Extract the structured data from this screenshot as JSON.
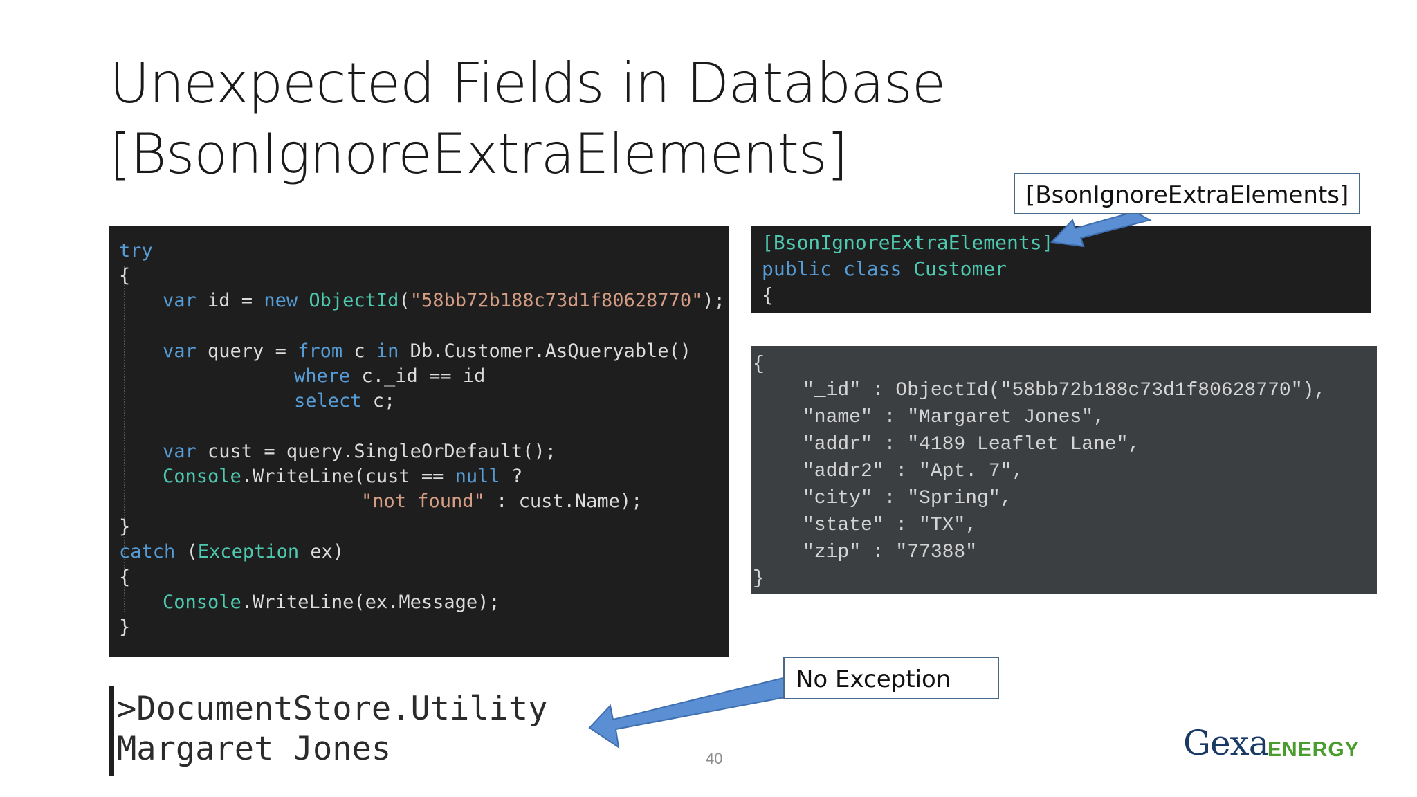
{
  "slide": {
    "title_line1": "Unexpected Fields in Database",
    "title_line2": "[BsonIgnoreExtraElements]",
    "page_number": "40"
  },
  "code_left": {
    "try_kw": "try",
    "open1": "{",
    "l3_var": "var",
    "l3_id": " id = ",
    "l3_new": "new",
    "l3_type": " ObjectId",
    "l3_paren": "(",
    "l3_str": "\"58bb72b188c73d1f80628770\"",
    "l3_end": ");",
    "l4_var": "var",
    "l4_query": " query = ",
    "l4_from": "from",
    "l4_c": " c ",
    "l4_in": "in",
    "l4_rest": " Db.Customer.AsQueryable()",
    "l5_where": "where",
    "l5_rest": " c._id == id",
    "l6_select": "select",
    "l6_rest": " c;",
    "l7_var": "var",
    "l7_rest": " cust = query.SingleOrDefault();",
    "l8_console": "Console",
    "l8_mid": ".WriteLine(cust == ",
    "l8_null": "null",
    "l8_end": " ?",
    "l9_str": "\"not found\"",
    "l9_rest": " : cust.Name);",
    "close1": "}",
    "catch_kw": "catch",
    "catch_open": " (",
    "exception_type": "Exception",
    "catch_rest": " ex)",
    "open2": "{",
    "l10_console": "Console",
    "l10_rest": ".WriteLine(ex.Message);",
    "close2": "}"
  },
  "code_class": {
    "attribute": "[BsonIgnoreExtraElements]",
    "public_kw": "public",
    "class_kw": " class",
    "class_name": " Customer",
    "open": "{"
  },
  "json_doc": {
    "open": "{",
    "rows": [
      "\"_id\" : ObjectId(\"58bb72b188c73d1f80628770\"),",
      "\"name\" : \"Margaret Jones\",",
      "\"addr\" : \"4189 Leaflet Lane\",",
      "\"addr2\" : \"Apt. 7\",",
      "\"city\" : \"Spring\",",
      "\"state\" : \"TX\",",
      "\"zip\" : \"77388\""
    ],
    "close": "}"
  },
  "callouts": {
    "attribute_label": "[BsonIgnoreExtraElements]",
    "no_exception_label": "No Exception"
  },
  "console_output": {
    "line1": ">DocumentStore.Utility",
    "line2": "Margaret Jones"
  },
  "logo": {
    "brand": "Gexa",
    "suffix": "ENERGY"
  },
  "colors": {
    "arrow": "#5b8fd3",
    "code_bg": "#1e1e1e",
    "json_bg": "#3c3f41",
    "keyword": "#569cd6",
    "type": "#4ec9b0",
    "string": "#d69d85"
  }
}
